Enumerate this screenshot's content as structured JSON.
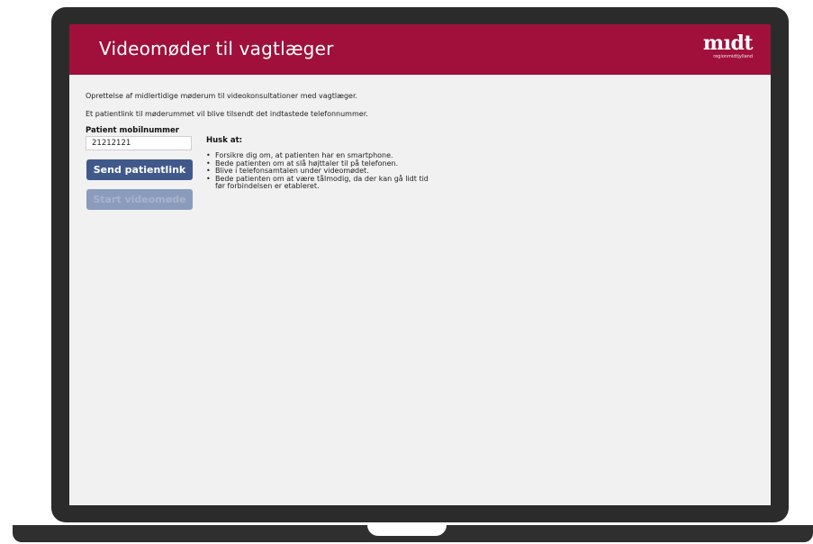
{
  "header": {
    "title": "Videomøder til vagtlæger",
    "logo_word": "mıdt",
    "logo_sub": "regionmidtjylland",
    "brand_color": "#a0103a"
  },
  "intro": {
    "line1": "Oprettelse af midlertidige møderum til videokonsultationer med vagtlæger.",
    "line2": "Et patientlink til møderummet vil blive tilsendt det indtastede telefonnummer."
  },
  "form": {
    "phone_label": "Patient mobilnummer",
    "phone_value": "21212121",
    "send_button": "Send patientlink",
    "start_button": "Start videomøde",
    "button_color": "#41598a"
  },
  "reminders": {
    "title": "Husk at:",
    "bullet": "•",
    "items": [
      "Forsikre dig om, at patienten har en smartphone.",
      "Bede patienten om at slå højttaler til på telefonen.",
      "Blive i telefonsamtalen under videomødet.",
      "Bede patienten om at være tålmodig, da der kan gå lidt tid før forbindelsen er etableret."
    ]
  }
}
